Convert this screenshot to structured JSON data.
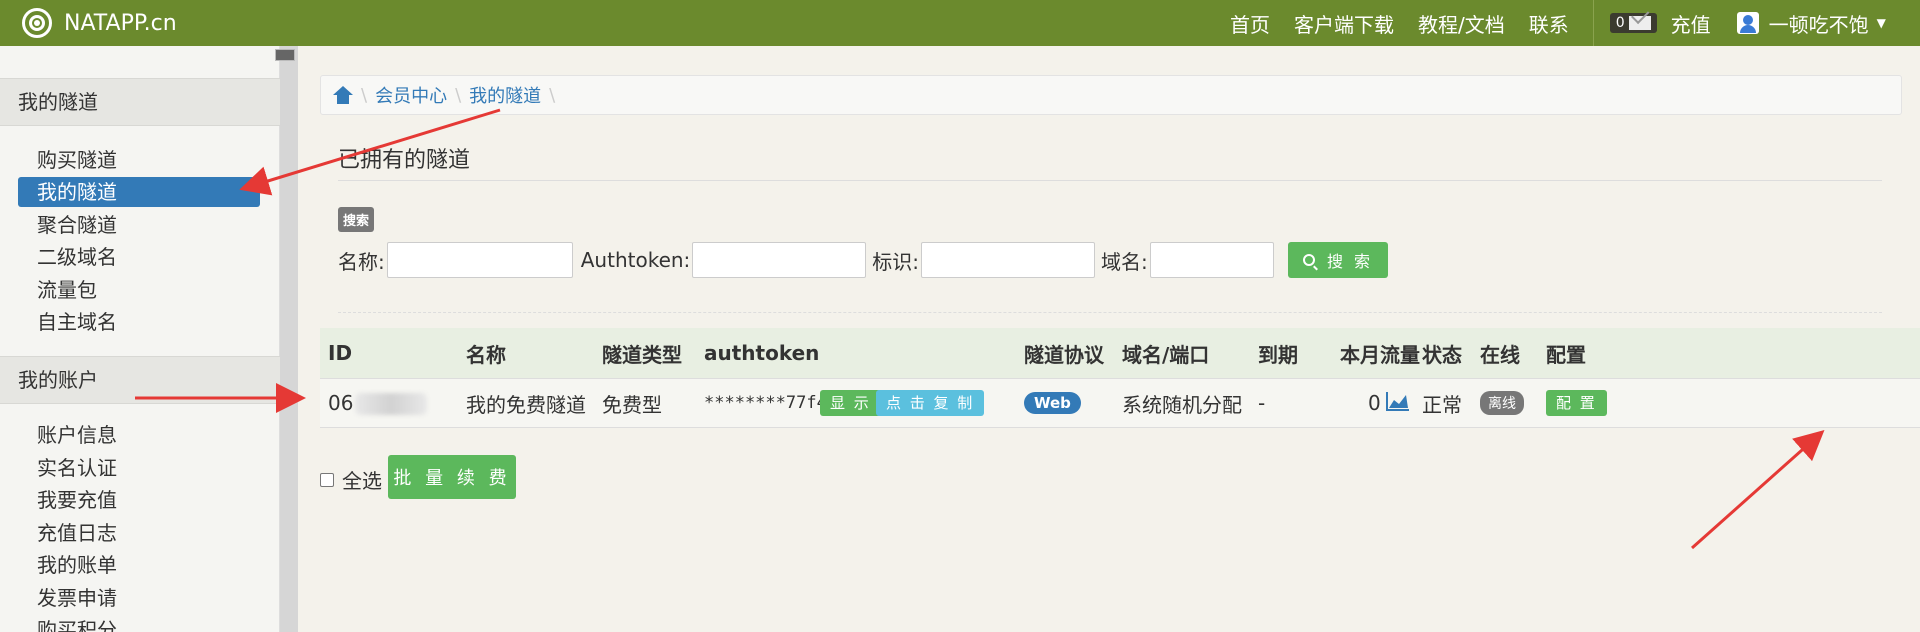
{
  "topbar": {
    "brand": "NATAPP.cn",
    "nav": [
      "首页",
      "客户端下载",
      "教程/文档",
      "联系"
    ],
    "mail_count": "0",
    "recharge": "充值",
    "user": "一顿吃不饱"
  },
  "sidebar": {
    "sections": [
      {
        "title": "我的隧道",
        "items": [
          "购买隧道",
          "我的隧道",
          "聚合隧道",
          "二级域名",
          "流量包",
          "自主域名"
        ]
      },
      {
        "title": "我的账户",
        "items": [
          "账户信息",
          "实名认证",
          "我要充值",
          "充值日志",
          "我的账单",
          "发票申请",
          "购买积分"
        ]
      }
    ],
    "active_item": "我的隧道"
  },
  "breadcrumb": [
    "会员中心",
    "我的隧道"
  ],
  "page_title": "已拥有的隧道",
  "search": {
    "label": "搜索",
    "fields": [
      "名称:",
      "Authtoken:",
      "标识:",
      "域名:"
    ],
    "button": "搜 索"
  },
  "table": {
    "headers": [
      "ID",
      "名称",
      "隧道类型",
      "authtoken",
      "隧道协议",
      "域名/端口",
      "到期",
      "本月流量",
      "状态",
      "在线",
      "配置"
    ],
    "rows": [
      {
        "id": "06",
        "name": "我的免费隧道",
        "type": "免费型",
        "authtoken": "********77f4",
        "show_btn": "显 示",
        "copy_btn": "点 击 复 制",
        "protocol": "Web",
        "domain": "系统随机分配",
        "expire": "-",
        "traffic": "0",
        "status": "正常",
        "online": "离线",
        "config_btn": "配 置"
      }
    ]
  },
  "footer": {
    "select_all": "全选",
    "batch_renew": "批 量 续 费"
  },
  "colors": {
    "topbar": "#6b8a2d",
    "primary": "#337ab7",
    "success": "#5cb85c",
    "info": "#5bc0de",
    "arrow": "#e53935"
  }
}
